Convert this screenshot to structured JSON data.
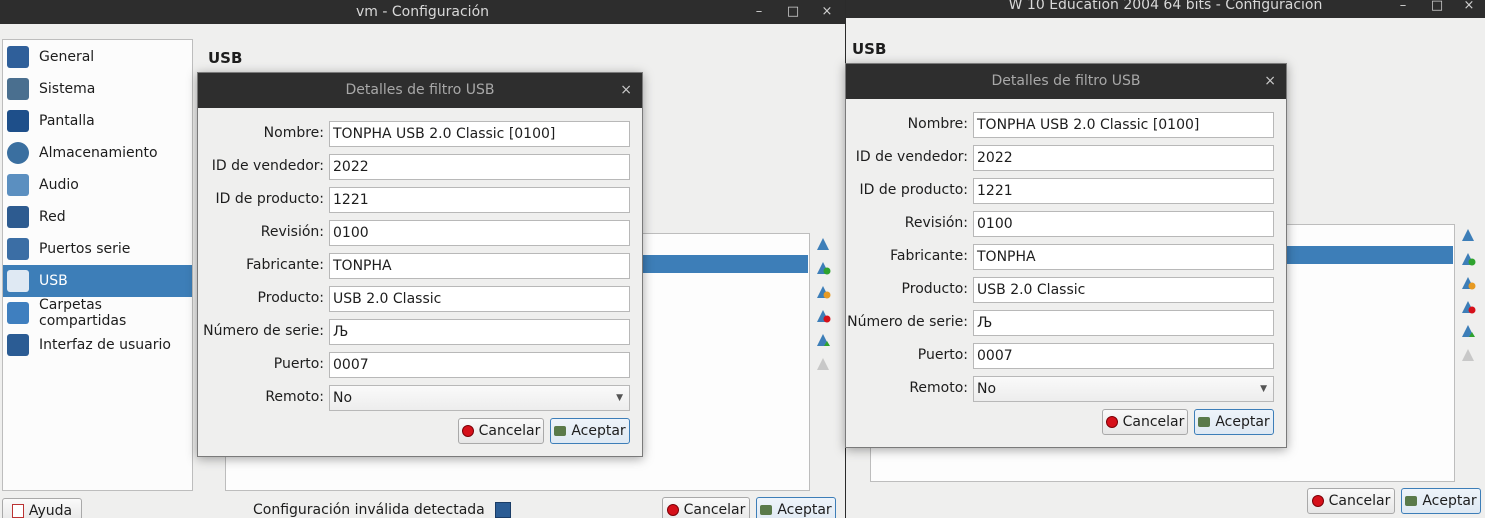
{
  "left_window": {
    "title": "vm - Configuración",
    "controls": {
      "minimize": "–",
      "maximize": "□",
      "close": "×"
    },
    "sidebar": [
      {
        "label": "General",
        "color": "#2f5f9a"
      },
      {
        "label": "Sistema",
        "color": "#4a6f8f"
      },
      {
        "label": "Pantalla",
        "color": "#1e4f8a"
      },
      {
        "label": "Almacenamiento",
        "color": "#3a6fa0"
      },
      {
        "label": "Audio",
        "color": "#5b8fc0"
      },
      {
        "label": "Red",
        "color": "#2d5b90"
      },
      {
        "label": "Puertos serie",
        "color": "#3b6ea5"
      },
      {
        "label": "USB",
        "color": "#ffffff"
      },
      {
        "label": "Carpetas compartidas",
        "color": "#3f7fbf"
      },
      {
        "label": "Interfaz de usuario",
        "color": "#2b5c94"
      }
    ],
    "section_title": "USB",
    "help_button": "Ayuda",
    "status_text": "Configuración inválida detectada",
    "cancel_button": "Cancelar",
    "accept_button": "Aceptar"
  },
  "right_window": {
    "title": "W 10 Education 2004 64 bits - Configuración",
    "controls": {
      "minimize": "–",
      "maximize": "□",
      "close": "×"
    },
    "section_title": "USB",
    "cancel_button": "Cancelar",
    "accept_button": "Aceptar"
  },
  "dialog_left": {
    "title": "Detalles de filtro USB",
    "close": "×",
    "fields": [
      {
        "label": "Nombre:",
        "value": "TONPHA USB 2.0 Classic [0100]"
      },
      {
        "label": "ID de vendedor:",
        "value": "2022"
      },
      {
        "label": "ID de producto:",
        "value": "1221"
      },
      {
        "label": "Revisión:",
        "value": "0100"
      },
      {
        "label": "Fabricante:",
        "value": "TONPHA"
      },
      {
        "label": "Producto:",
        "value": "USB 2.0 Classic"
      },
      {
        "label": "Número de serie:",
        "value": "Љ"
      },
      {
        "label": "Puerto:",
        "value": "0007"
      }
    ],
    "remote": {
      "label": "Remoto:",
      "value": "No"
    },
    "cancel_button": "Cancelar",
    "accept_button": "Aceptar"
  },
  "dialog_right": {
    "title": "Detalles de filtro USB",
    "close": "×",
    "fields": [
      {
        "label": "Nombre:",
        "value": "TONPHA USB 2.0 Classic [0100]"
      },
      {
        "label": "ID de vendedor:",
        "value": "2022"
      },
      {
        "label": "ID de producto:",
        "value": "1221"
      },
      {
        "label": "Revisión:",
        "value": "0100"
      },
      {
        "label": "Fabricante:",
        "value": "TONPHA"
      },
      {
        "label": "Producto:",
        "value": "USB 2.0 Classic"
      },
      {
        "label": "Número de serie:",
        "value": "Љ"
      },
      {
        "label": "Puerto:",
        "value": "0007"
      }
    ],
    "remote": {
      "label": "Remoto:",
      "value": "No"
    },
    "cancel_button": "Cancelar",
    "accept_button": "Aceptar"
  }
}
